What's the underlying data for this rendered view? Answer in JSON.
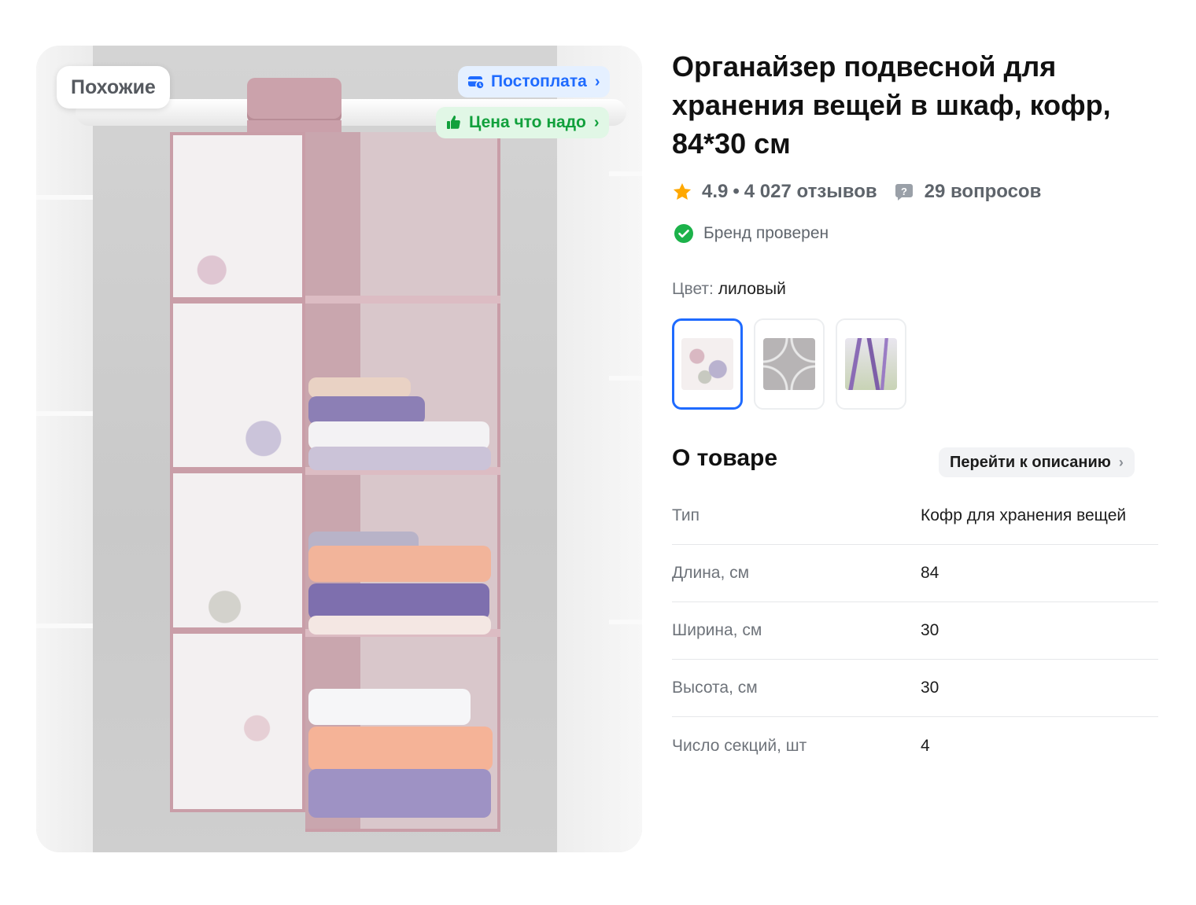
{
  "gallery": {
    "similar_label": "Похожие",
    "badges": {
      "postpay": {
        "label": "Постоплата",
        "icon": "card-clock-icon",
        "color": "#1f6bff"
      },
      "fair_price": {
        "label": "Цена что надо",
        "icon": "thumbs-up-icon",
        "color": "#11a03c"
      }
    }
  },
  "product": {
    "title": "Органайзер подвесной для хранения вещей в шкаф, кофр, 84*30 см",
    "rating": "4.9",
    "separator": "•",
    "reviews": "4 027 отзывов",
    "questions": "29 вопросов",
    "brand_verified": "Бренд проверен"
  },
  "color": {
    "label": "Цвет:",
    "value": "лиловый",
    "swatches": [
      "floral-swatch",
      "geometric-grey-swatch",
      "lavender-swatch"
    ],
    "selected_index": 0
  },
  "about": {
    "heading": "О товаре",
    "goto_label": "Перейти к описанию",
    "specs": [
      {
        "key": "Тип",
        "value": "Кофр для хранения вещей"
      },
      {
        "key": "Длина, см",
        "value": "84"
      },
      {
        "key": "Ширина, см",
        "value": "30"
      },
      {
        "key": "Высота, см",
        "value": "30"
      },
      {
        "key": "Число секций, шт",
        "value": "4"
      }
    ]
  },
  "colors": {
    "accent": "#1f6bff",
    "success": "#11a03c",
    "star": "#ffa800"
  }
}
